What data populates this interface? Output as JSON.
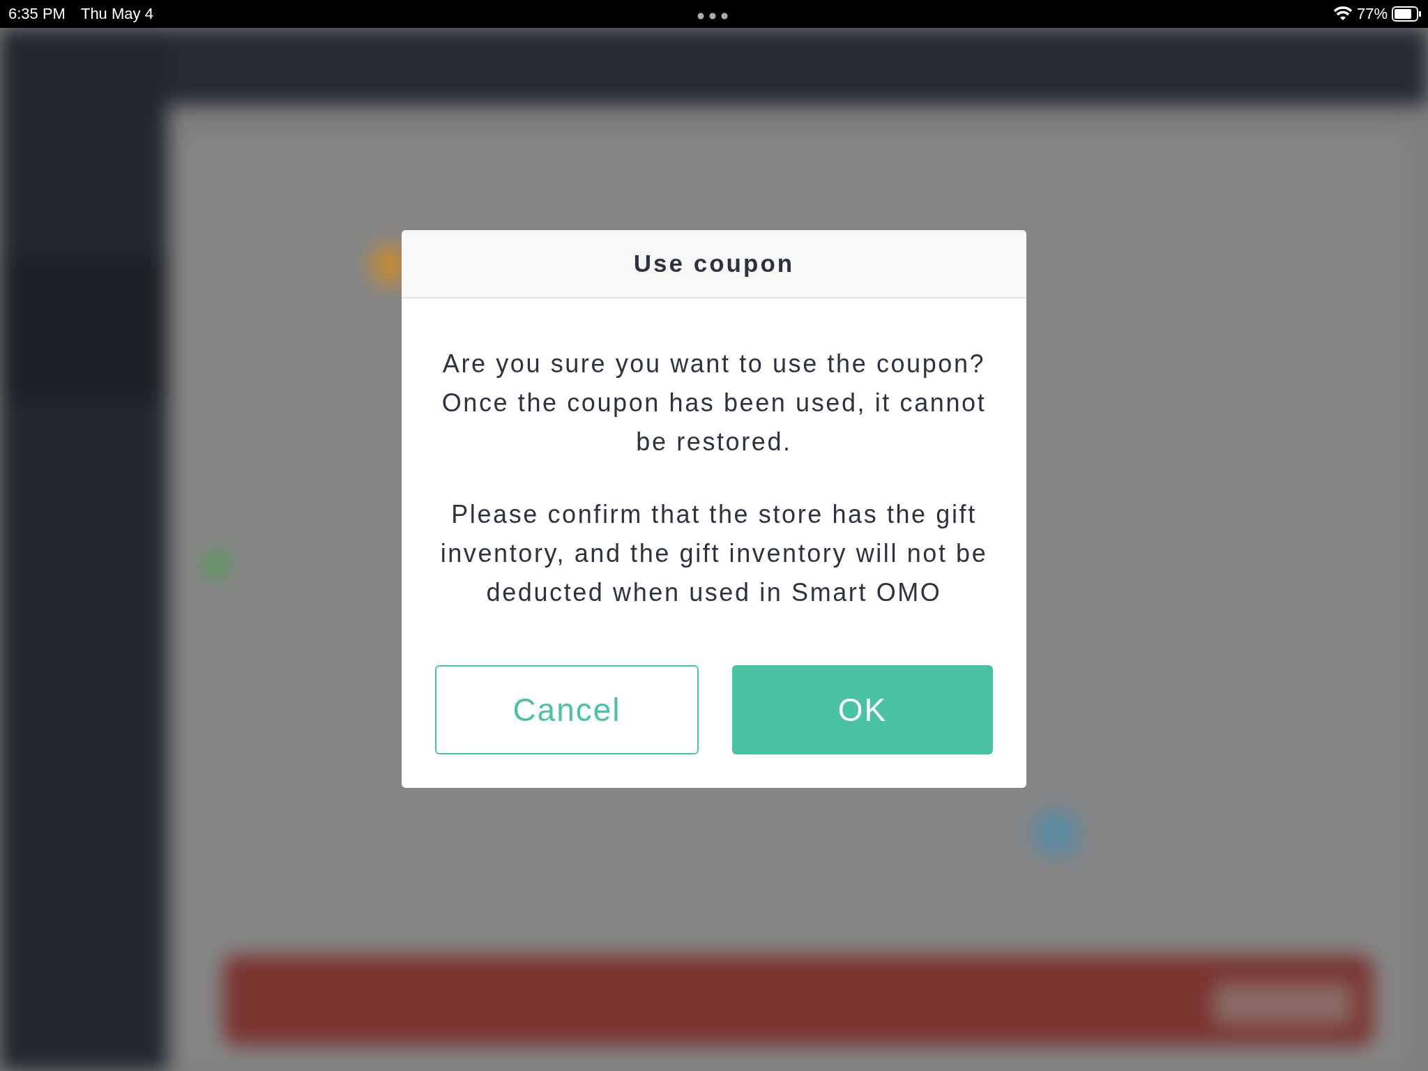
{
  "status_bar": {
    "time": "6:35 PM",
    "date": "Thu May 4",
    "battery": "77%"
  },
  "dialog": {
    "title": "Use coupon",
    "paragraphs": [
      "Are you sure you want to use the coupon?\nOnce the coupon has been used, it cannot be restored.",
      "Please confirm that the store has the gift inventory, and the gift inventory will not be deducted when used in Smart OMO"
    ],
    "buttons": [
      {
        "label": "Cancel",
        "kind": "secondary"
      },
      {
        "label": "OK",
        "kind": "primary"
      }
    ]
  }
}
